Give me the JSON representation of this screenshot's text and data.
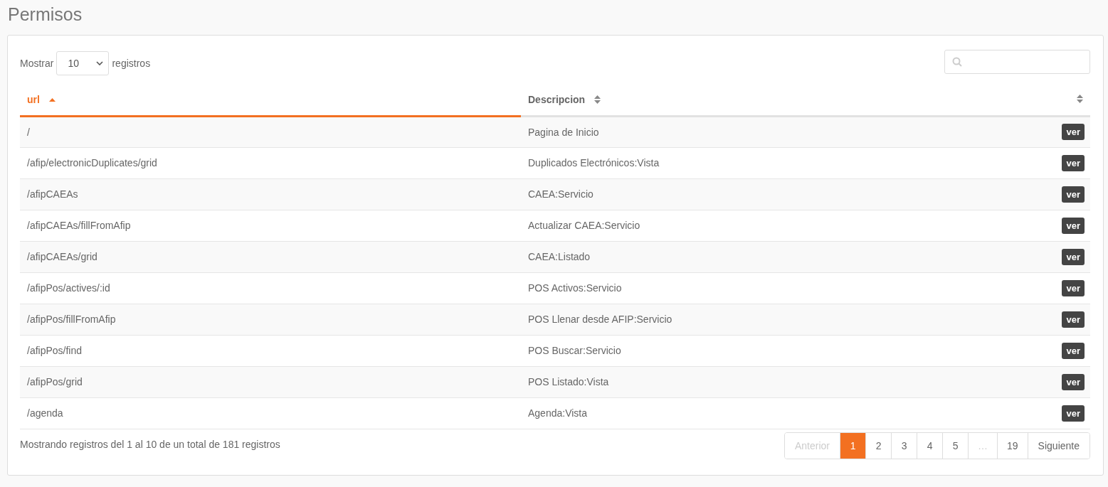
{
  "title": "Permisos",
  "length_control": {
    "before": "Mostrar",
    "value": "10",
    "after": "registros"
  },
  "table": {
    "columns": [
      {
        "label": "url",
        "sorted": true
      },
      {
        "label": "Descripcion",
        "sorted": false
      },
      {
        "sorted": false
      }
    ],
    "rows": [
      {
        "url": "/",
        "description": "Pagina de Inicio",
        "action": "ver"
      },
      {
        "url": "/afip/electronicDuplicates/grid",
        "description": "Duplicados Electrónicos:Vista",
        "action": "ver"
      },
      {
        "url": "/afipCAEAs",
        "description": "CAEA:Servicio",
        "action": "ver"
      },
      {
        "url": "/afipCAEAs/fillFromAfip",
        "description": "Actualizar CAEA:Servicio",
        "action": "ver"
      },
      {
        "url": "/afipCAEAs/grid",
        "description": "CAEA:Listado",
        "action": "ver"
      },
      {
        "url": "/afipPos/actives/:id",
        "description": "POS Activos:Servicio",
        "action": "ver"
      },
      {
        "url": "/afipPos/fillFromAfip",
        "description": "POS Llenar desde AFIP:Servicio",
        "action": "ver"
      },
      {
        "url": "/afipPos/find",
        "description": "POS Buscar:Servicio",
        "action": "ver"
      },
      {
        "url": "/afipPos/grid",
        "description": "POS Listado:Vista",
        "action": "ver"
      },
      {
        "url": "/agenda",
        "description": "Agenda:Vista",
        "action": "ver"
      }
    ]
  },
  "info": "Mostrando registros del 1 al 10 de un total de 181 registros",
  "pagination": [
    {
      "label": "Anterior",
      "kind": "prev",
      "selected": false,
      "disabled": true
    },
    {
      "label": "1",
      "kind": "page",
      "selected": true,
      "disabled": false
    },
    {
      "label": "2",
      "kind": "page",
      "selected": false,
      "disabled": false
    },
    {
      "label": "3",
      "kind": "page",
      "selected": false,
      "disabled": false
    },
    {
      "label": "4",
      "kind": "page",
      "selected": false,
      "disabled": false
    },
    {
      "label": "5",
      "kind": "page",
      "selected": false,
      "disabled": false
    },
    {
      "label": "…",
      "kind": "ellipsis",
      "selected": false,
      "disabled": true
    },
    {
      "label": "19",
      "kind": "page",
      "selected": false,
      "disabled": false
    },
    {
      "label": "Siguiente",
      "kind": "next",
      "selected": false,
      "disabled": false
    }
  ]
}
